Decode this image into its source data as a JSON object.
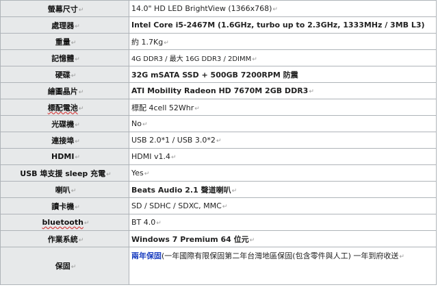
{
  "specs": [
    {
      "label": "螢幕尺寸",
      "value": "14.0\" HD LED BrightView (1366x768)"
    },
    {
      "label": "處理器",
      "value": "Intel Core i5-2467M (1.6GHz, turbo up to 2.3GHz, 1333MHz / 3MB L3)"
    },
    {
      "label": "重量",
      "value": "約 1.7Kg"
    },
    {
      "label": "記憶體",
      "value": "4G DDR3 / 最大 16G DDR3 / 2DIMM"
    },
    {
      "label": "硬碟",
      "value": "32G mSATA SSD + 500GB 7200RPM 防震"
    },
    {
      "label": "繪圖晶片",
      "value": "ATI Mobility Radeon HD 7670M 2GB DDR3"
    },
    {
      "label": "標配電池",
      "value": "標配 4cell 52Whr"
    },
    {
      "label": "光碟機",
      "value": "No"
    },
    {
      "label": "連接埠",
      "value": "USB 2.0*1 / USB 3.0*2"
    },
    {
      "label": "HDMI",
      "value": "HDMI v1.4"
    },
    {
      "label": "USB 埠支援 sleep 充電",
      "value": "Yes"
    },
    {
      "label": "喇叭",
      "value": "Beats Audio 2.1 聲道喇叭"
    },
    {
      "label": "讀卡機",
      "value": "SD / SDHC / SDXC, MMC"
    },
    {
      "label": "bluetooth",
      "value": "BT 4.0"
    },
    {
      "label": "作業系統",
      "value": "Windows 7 Premium 64 位元"
    },
    {
      "label": "保固",
      "value_prefix": "兩年保固",
      "value": "(一年國際有限保固第二年台灣地區保固(包含零件與人工) 一年到府收送"
    }
  ],
  "paragraph_mark": "↵",
  "colors": {
    "label_bg": "#e7e9ea",
    "border": "#aeb3b8",
    "red": "#e0201f",
    "magenta": "#e5158b",
    "blue": "#1b3fc0"
  }
}
